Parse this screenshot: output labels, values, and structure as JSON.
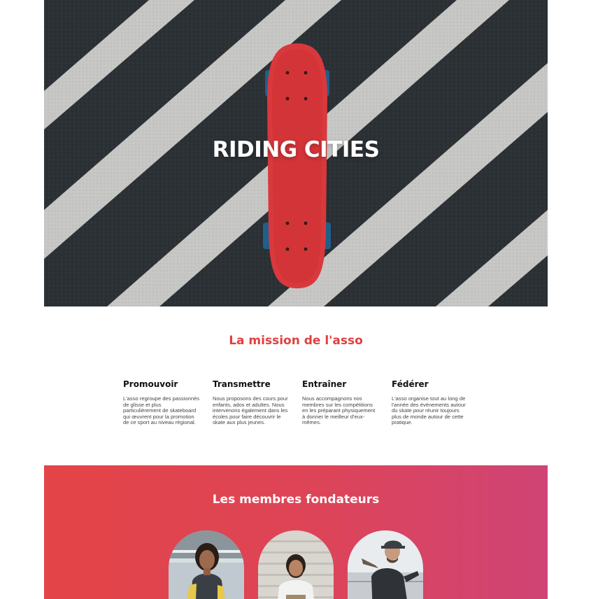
{
  "hero": {
    "title": "RIDING CITIES",
    "image_icon": "skateboard-on-crosswalk-image"
  },
  "mission": {
    "title": "La mission de l'asso",
    "items": [
      {
        "heading": "Promouvoir",
        "text": "L'asso regroupe des passionnés de glisse et plus particulièrement de skateboard qui œuvrent pour la promotion de ce sport au niveau régional."
      },
      {
        "heading": "Transmettre",
        "text": "Nous proposons des cours pour enfants, ados et adultes. Nous intervenons également dans les écoles pour faire découvrir le skate aux plus jeunes."
      },
      {
        "heading": "Entraîner",
        "text": "Nous accompagnons nos membres sur les compétitions en les préparant physiquement à donner le meilleur d'eux-mêmes."
      },
      {
        "heading": "Fédérer",
        "text": "L'asso organise tout au long de l'année des évènements autour du skate pour réunir toujours plus de monde autour de cette pratique."
      }
    ]
  },
  "founders": {
    "title": "Les membres fondateurs",
    "members": [
      {
        "photo_icon": "founder-photo-woman"
      },
      {
        "photo_icon": "founder-photo-man-seated"
      },
      {
        "photo_icon": "founder-photo-man-skating"
      }
    ]
  },
  "colors": {
    "accent": "#e0403f",
    "gradient_start": "#e34446",
    "gradient_end": "#cf4476",
    "skateboard": "#d9383c",
    "asphalt": "#2a2f33",
    "stripe": "#c9c9c9"
  }
}
